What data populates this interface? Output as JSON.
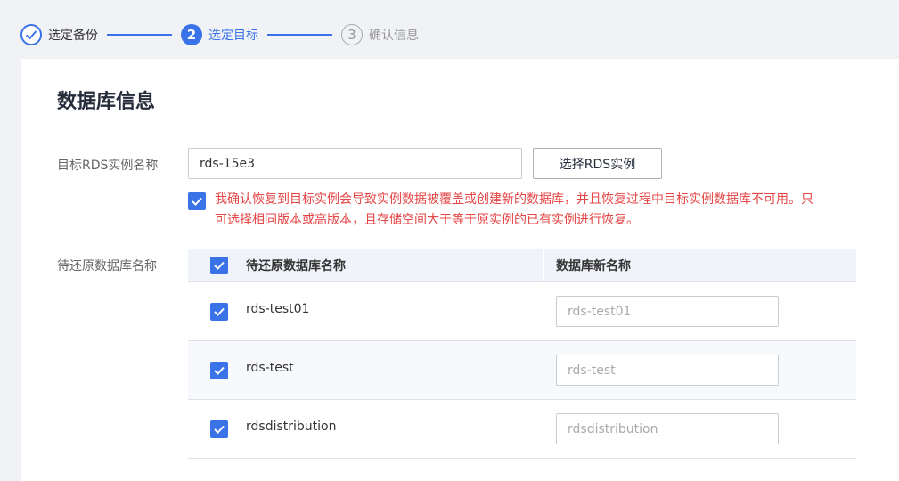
{
  "stepper": {
    "steps": [
      {
        "index": "1",
        "label": "选定备份",
        "state": "done"
      },
      {
        "index": "2",
        "label": "选定目标",
        "state": "active"
      },
      {
        "index": "3",
        "label": "确认信息",
        "state": "pending"
      }
    ]
  },
  "section": {
    "title": "数据库信息"
  },
  "target": {
    "label": "目标RDS实例名称",
    "value": "rds-15e3",
    "select_button": "选择RDS实例"
  },
  "confirm": {
    "checked": true,
    "line1": "我确认恢复到目标实例会导致实例数据被覆盖或创建新的数据库，并且恢复过程中目标实例数据库不可用。只",
    "line2": "可选择相同版本或高版本，且存储空间大于等于原实例的已有实例进行恢复。"
  },
  "restore": {
    "label": "待还原数据库名称",
    "columns": [
      "待还原数据库名称",
      "数据库新名称"
    ],
    "rows": [
      {
        "name": "rds-test01",
        "new_name_placeholder": "rds-test01",
        "checked": true
      },
      {
        "name": "rds-test",
        "new_name_placeholder": "rds-test",
        "checked": true
      },
      {
        "name": "rdsdistribution",
        "new_name_placeholder": "rdsdistribution",
        "checked": true
      }
    ]
  },
  "colors": {
    "accent": "#3a72e8",
    "warning": "#e54545"
  }
}
